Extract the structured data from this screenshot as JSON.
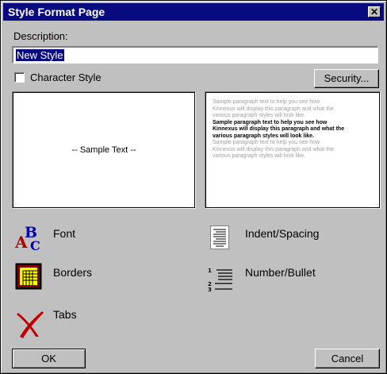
{
  "window": {
    "title": "Style Format Page",
    "close_glyph": "✕"
  },
  "form": {
    "description_label": "Description:",
    "description_value": "New Style",
    "character_style_label": "Character Style",
    "character_style_checked": false,
    "security_button": "Security..."
  },
  "preview": {
    "sample_text": "-- Sample Text --",
    "paragraph_lines": [
      {
        "text": "Sample paragraph text to help you see how",
        "emphasis": false
      },
      {
        "text": "Kinnexus will display this paragraph and what the",
        "emphasis": false
      },
      {
        "text": "various paragraph styles will look like.",
        "emphasis": false
      },
      {
        "text": "Sample paragraph text to help you see how",
        "emphasis": true
      },
      {
        "text": "Kinnexus will display this paragraph and what the",
        "emphasis": true
      },
      {
        "text": "various paragraph styles will look like.",
        "emphasis": true
      },
      {
        "text": "Sample paragraph text to help you see how",
        "emphasis": false
      },
      {
        "text": "Kinnexus will display this paragraph and what the",
        "emphasis": false
      },
      {
        "text": "various paragraph styles will look like.",
        "emphasis": false
      }
    ]
  },
  "options": {
    "font": {
      "label": "Font",
      "icon": "font-abc-icon"
    },
    "borders": {
      "label": "Borders",
      "icon": "borders-icon"
    },
    "tabs": {
      "label": "Tabs",
      "icon": "tabs-icon"
    },
    "indent": {
      "label": "Indent/Spacing",
      "icon": "indent-spacing-icon"
    },
    "number": {
      "label": "Number/Bullet",
      "icon": "number-bullet-icon"
    }
  },
  "buttons": {
    "ok": "OK",
    "cancel": "Cancel"
  },
  "colors": {
    "titlebar": "#0a0a80",
    "face": "#c0c0c0",
    "selection": "#0a0a80"
  }
}
